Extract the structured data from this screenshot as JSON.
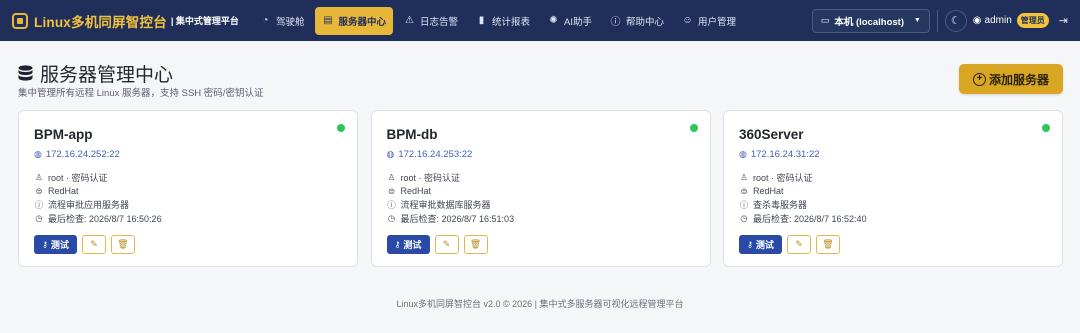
{
  "navbar": {
    "brand_title": "Linux多机同屏智控台",
    "brand_sub": "| 集中式管理平台",
    "items": [
      {
        "label": "驾驶舱",
        "icon": "dashboard-icon",
        "active": false
      },
      {
        "label": "服务器中心",
        "icon": "server-icon",
        "active": true
      },
      {
        "label": "日志告警",
        "icon": "warning-icon",
        "active": false
      },
      {
        "label": "统计报表",
        "icon": "bar-chart-icon",
        "active": false
      },
      {
        "label": "AI助手",
        "icon": "ai-icon",
        "active": false
      },
      {
        "label": "帮助中心",
        "icon": "help-icon",
        "active": false
      },
      {
        "label": "用户管理",
        "icon": "users-icon",
        "active": false
      }
    ],
    "server_select": "本机 (localhost)",
    "user_name": "admin",
    "user_role": "管理员"
  },
  "header": {
    "title": "服务器管理中心",
    "subtitle": "集中管理所有远程 Linux 服务器，支持 SSH 密码/密钥认证",
    "add_button": "添加服务器"
  },
  "servers": [
    {
      "name": "BPM-app",
      "ip": "172.16.24.252:22",
      "auth": "root · 密码认证",
      "os": "RedHat",
      "desc": "流程审批应用服务器",
      "last_check": "最后检查: 2026/8/7 16:50:26",
      "status": "online"
    },
    {
      "name": "BPM-db",
      "ip": "172.16.24.253:22",
      "auth": "root · 密码认证",
      "os": "RedHat",
      "desc": "流程审批数据库服务器",
      "last_check": "最后检查: 2026/8/7 16:51:03",
      "status": "online"
    },
    {
      "name": "360Server",
      "ip": "172.16.24.31:22",
      "auth": "root · 密码认证",
      "os": "RedHat",
      "desc": "查杀毒服务器",
      "last_check": "最后检查: 2026/8/7 16:52:40",
      "status": "online"
    }
  ],
  "card_actions": {
    "test_label": "测试"
  },
  "colors": {
    "navbar": "#1f2f5a",
    "accent": "#e8b73a",
    "online": "#2cc65a",
    "primary": "#2a4aa8"
  },
  "footer": "Linux多机同屏智控台 v2.0 © 2026 | 集中式多服务器可视化远程管理平台"
}
